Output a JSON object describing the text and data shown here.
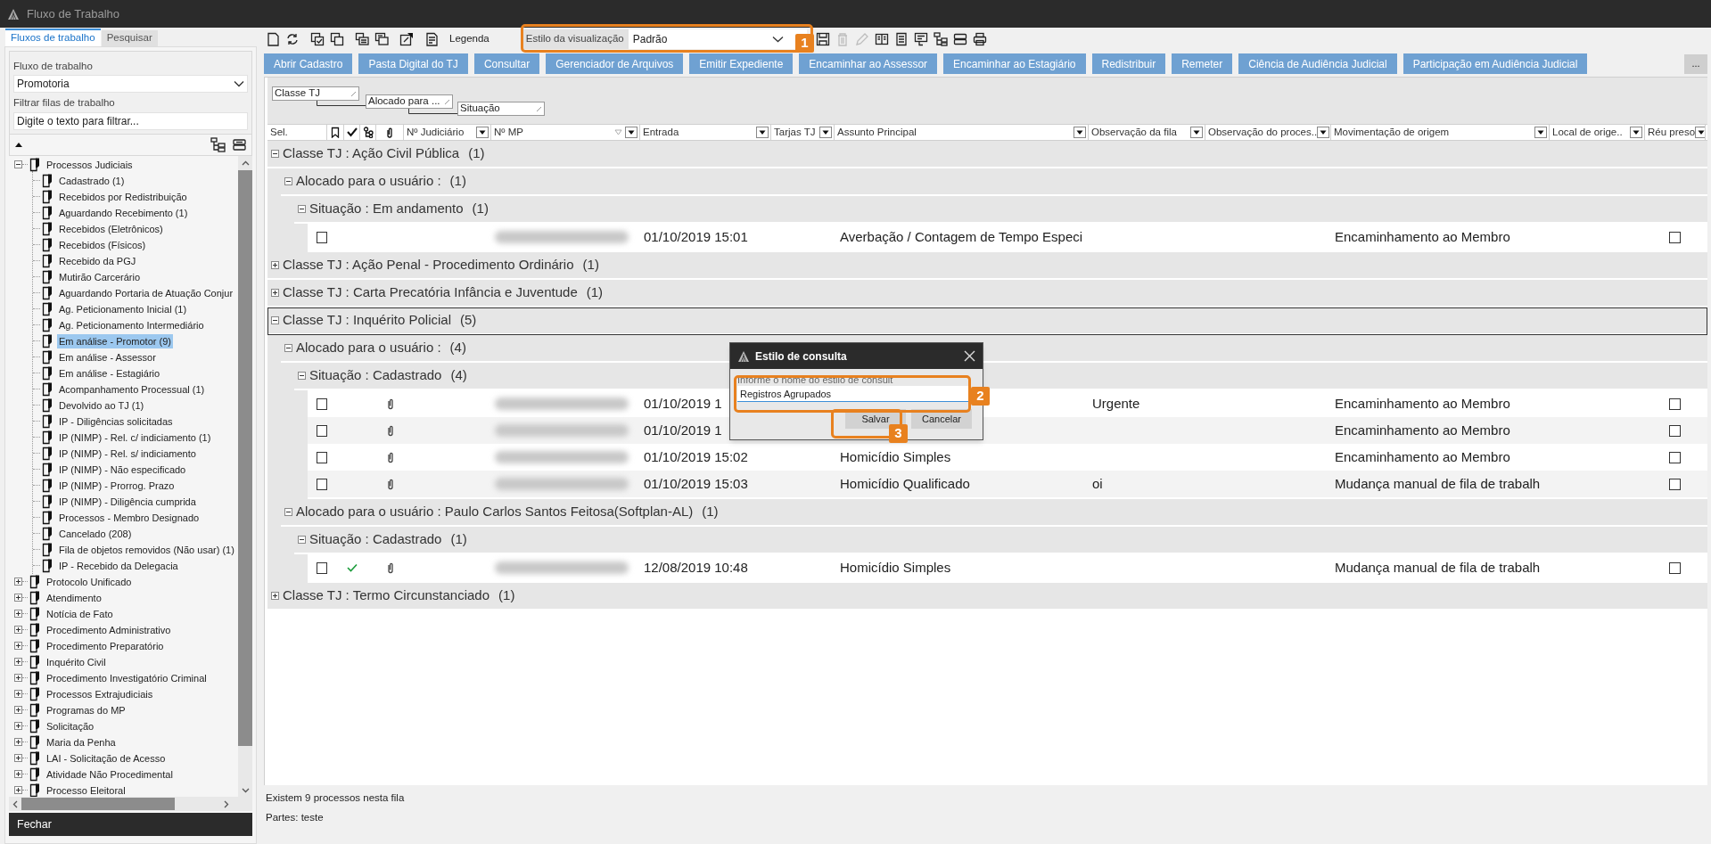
{
  "window": {
    "title": "Fluxo de Trabalho"
  },
  "sidebar": {
    "tabs": [
      {
        "label": "Fluxos de trabalho",
        "selected": true
      },
      {
        "label": "Pesquisar",
        "selected": false
      }
    ],
    "workflow_label": "Fluxo de trabalho",
    "workflow_value": "Promotoria",
    "filter_label": "Filtrar filas de trabalho",
    "filter_placeholder": "Digite o texto para filtrar...",
    "tree": [
      {
        "label": "Processos Judiciais",
        "expanded": true,
        "selected": false,
        "children": [
          {
            "label": "Cadastrado (1)",
            "selected": false
          },
          {
            "label": "Recebidos por Redistribuição",
            "selected": false
          },
          {
            "label": "Aguardando Recebimento (1)",
            "selected": false
          },
          {
            "label": "Recebidos (Eletrônicos)",
            "selected": false
          },
          {
            "label": "Recebidos (Físicos)",
            "selected": false
          },
          {
            "label": "Recebido da PGJ",
            "selected": false
          },
          {
            "label": "Mutirão Carcerário",
            "selected": false
          },
          {
            "label": "Aguardando Portaria de Atuação Conjur",
            "selected": false
          },
          {
            "label": "Ag. Peticionamento Inicial (1)",
            "selected": false
          },
          {
            "label": "Ag. Peticionamento Intermediário",
            "selected": false
          },
          {
            "label": "Em análise - Promotor (9)",
            "selected": true
          },
          {
            "label": "Em análise - Assessor",
            "selected": false
          },
          {
            "label": "Em análise - Estagiário",
            "selected": false
          },
          {
            "label": "Acompanhamento Processual (1)",
            "selected": false
          },
          {
            "label": "Devolvido ao TJ (1)",
            "selected": false
          },
          {
            "label": "IP - Diligências solicitadas",
            "selected": false
          },
          {
            "label": "IP (NIMP) - Rel. c/ indiciamento (1)",
            "selected": false
          },
          {
            "label": "IP (NIMP) - Rel. s/ indiciamento",
            "selected": false
          },
          {
            "label": "IP (NIMP) - Não especificado",
            "selected": false
          },
          {
            "label": "IP (NIMP) - Prorrog. Prazo",
            "selected": false
          },
          {
            "label": "IP (NIMP) - Diligência cumprida",
            "selected": false
          },
          {
            "label": "Processos - Membro Designado",
            "selected": false
          },
          {
            "label": "Cancelado (208)",
            "selected": false
          },
          {
            "label": "Fila de objetos removidos (Não usar) (1)",
            "selected": false
          },
          {
            "label": "IP - Recebido da Delegacia",
            "selected": false
          }
        ]
      },
      {
        "label": "Protocolo Unificado",
        "expanded": false,
        "selected": false
      },
      {
        "label": "Atendimento",
        "expanded": false,
        "selected": false
      },
      {
        "label": "Notícia de Fato",
        "expanded": false,
        "selected": false
      },
      {
        "label": "Procedimento Administrativo",
        "expanded": false,
        "selected": false
      },
      {
        "label": "Procedimento Preparatório",
        "expanded": false,
        "selected": false
      },
      {
        "label": "Inquérito Civil",
        "expanded": false,
        "selected": false
      },
      {
        "label": "Procedimento Investigatório Criminal",
        "expanded": false,
        "selected": false
      },
      {
        "label": "Processos Extrajudiciais",
        "expanded": false,
        "selected": false
      },
      {
        "label": "Programas do MP",
        "expanded": false,
        "selected": false
      },
      {
        "label": "Solicitação",
        "expanded": false,
        "selected": false
      },
      {
        "label": "Maria da Penha",
        "expanded": false,
        "selected": false
      },
      {
        "label": "LAI - Solicitação de Acesso",
        "expanded": false,
        "selected": false
      },
      {
        "label": "Atividade Não Procedimental",
        "expanded": false,
        "selected": false
      },
      {
        "label": "Processo Eleitoral",
        "expanded": false,
        "selected": false
      }
    ],
    "close_button": "Fechar"
  },
  "toolbar": {
    "legend_label": "Legenda",
    "view_style_label": "Estilo da visualização",
    "view_style_value": "Padrão",
    "right_icons": [
      {
        "disabled": false
      },
      {
        "disabled": true
      },
      {
        "disabled": true
      },
      {
        "disabled": false
      },
      {
        "disabled": false
      },
      {
        "disabled": false
      },
      {
        "disabled": false
      },
      {
        "disabled": false
      },
      {
        "disabled": false
      }
    ]
  },
  "actions": [
    "Abrir Cadastro",
    "Pasta Digital do TJ",
    "Consultar",
    "Gerenciador de Arquivos",
    "Emitir Expediente",
    "Encaminhar ao Assessor",
    "Encaminhar ao Estagiário",
    "Redistribuir",
    "Remeter",
    "Ciência de Audiência Judicial",
    "Participação em Audiência Judicial"
  ],
  "more_button": "...",
  "grouping": [
    {
      "label": "Classe TJ"
    },
    {
      "label": "Alocado para ..."
    },
    {
      "label": "Situação"
    }
  ],
  "columns": [
    {
      "kind": "text",
      "label": "Sel."
    },
    {
      "kind": "icon"
    },
    {
      "kind": "icon"
    },
    {
      "kind": "icon"
    },
    {
      "kind": "icon"
    },
    {
      "kind": "text",
      "label": "Nº Judiciário",
      "filter": true,
      "sorted": false
    },
    {
      "kind": "text",
      "label": "Nº MP",
      "filter": true,
      "sorted": true
    },
    {
      "kind": "text",
      "label": "Entrada",
      "filter": true,
      "sorted": false
    },
    {
      "kind": "text",
      "label": "Tarjas TJ",
      "filter": true,
      "sorted": false
    },
    {
      "kind": "text",
      "label": "Assunto Principal",
      "filter": true,
      "sorted": false
    },
    {
      "kind": "text",
      "label": "Observação da fila",
      "filter": true,
      "sorted": false
    },
    {
      "kind": "text",
      "label": "Observação do proces..",
      "filter": true,
      "sorted": false
    },
    {
      "kind": "text",
      "label": "Movimentação de origem",
      "filter": true,
      "sorted": false
    },
    {
      "kind": "text",
      "label": "Local de orige..",
      "filter": true,
      "sorted": false
    },
    {
      "kind": "text",
      "label": "Réu preso",
      "filter": true,
      "sorted": false
    }
  ],
  "groups": [
    {
      "label": "Classe TJ : Ação Civil Pública",
      "count": "(1)",
      "expanded": true,
      "focused": false,
      "children": [
        {
          "label": "Alocado para o usuário :",
          "count": "(1)",
          "expanded": true,
          "focused": false,
          "children": [
            {
              "label": "Situação : Em andamento",
              "count": "(1)",
              "expanded": true,
              "focused": false,
              "records": [
                {
                  "checked": false,
                  "validated": false,
                  "attachment": false,
                  "entrada": "01/10/2019 15:01",
                  "assunto": "Averbação / Contagem de Tempo Especi",
                  "movimentacao": "Encaminhamento ao Membro",
                  "reu_preso": false
                }
              ]
            }
          ]
        }
      ]
    },
    {
      "label": "Classe TJ : Ação Penal - Procedimento Ordinário",
      "count": "(1)",
      "expanded": false,
      "focused": false
    },
    {
      "label": "Classe TJ : Carta Precatória Infância e Juventude",
      "count": "(1)",
      "expanded": false,
      "focused": false
    },
    {
      "label": "Classe TJ : Inquérito Policial",
      "count": "(5)",
      "expanded": true,
      "focused": true,
      "children": [
        {
          "label": "Alocado para o usuário :",
          "count": "(4)",
          "expanded": true,
          "focused": false,
          "children": [
            {
              "label": "Situação : Cadastrado",
              "count": "(4)",
              "expanded": true,
              "focused": false,
              "records": [
                {
                  "checked": false,
                  "validated": false,
                  "attachment": true,
                  "entrada": "01/10/2019 1",
                  "observacao": "Urgente",
                  "movimentacao": "Encaminhamento ao Membro",
                  "reu_preso": false
                },
                {
                  "checked": false,
                  "validated": false,
                  "attachment": true,
                  "entrada": "01/10/2019 1",
                  "movimentacao": "Encaminhamento ao Membro",
                  "reu_preso": false
                },
                {
                  "checked": false,
                  "validated": false,
                  "attachment": true,
                  "entrada": "01/10/2019 15:02",
                  "assunto": "Homicídio Simples",
                  "movimentacao": "Encaminhamento ao Membro",
                  "reu_preso": false
                },
                {
                  "checked": false,
                  "validated": false,
                  "attachment": true,
                  "entrada": "01/10/2019 15:03",
                  "assunto": "Homicídio Qualificado",
                  "observacao": "oi",
                  "movimentacao": "Mudança manual de fila de trabalh",
                  "reu_preso": false
                }
              ]
            }
          ]
        },
        {
          "label": "Alocado para o usuário : Paulo Carlos Santos Feitosa(Softplan-AL)",
          "count": "(1)",
          "expanded": true,
          "focused": false,
          "children": [
            {
              "label": "Situação : Cadastrado",
              "count": "(1)",
              "expanded": true,
              "focused": false,
              "records": [
                {
                  "checked": false,
                  "validated": true,
                  "attachment": true,
                  "entrada": "12/08/2019 10:48",
                  "assunto": "Homicídio Simples",
                  "movimentacao": "Mudança manual de fila de trabalh",
                  "reu_preso": false
                }
              ]
            }
          ]
        }
      ]
    },
    {
      "label": "Classe TJ : Termo Circunstanciado",
      "count": "(1)",
      "expanded": false,
      "focused": false
    }
  ],
  "status": {
    "summary": "Existem 9 processos nesta fila",
    "parties": "Partes: teste"
  },
  "dialog": {
    "title": "Estilo de consulta",
    "field_label": "Informe o nome do estilo de consult",
    "field_value": "Registros Agrupados",
    "buttons": [
      "Salvar",
      "Cancelar"
    ]
  },
  "callouts": [
    {
      "number": "1"
    },
    {
      "number": "2"
    },
    {
      "number": "3"
    }
  ]
}
